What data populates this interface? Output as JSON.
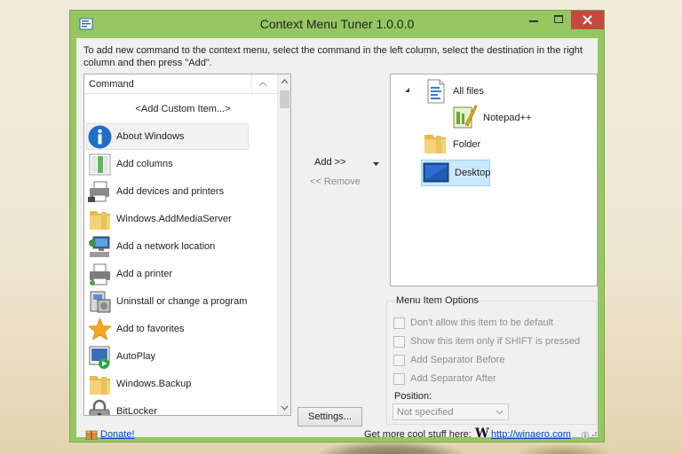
{
  "window": {
    "title": "Context Menu Tuner 1.0.0.0"
  },
  "instructions": "To add new command to the context menu, select the command in the left column, select the destination in the right column and then press \"Add\".",
  "command_list": {
    "header": "Command",
    "items": [
      {
        "label": "<Add Custom Item...>",
        "icon": "none"
      },
      {
        "label": "About Windows",
        "icon": "info-icon"
      },
      {
        "label": "Add columns",
        "icon": "columns-icon"
      },
      {
        "label": "Add devices and printers",
        "icon": "devices-printers-icon"
      },
      {
        "label": "Windows.AddMediaServer",
        "icon": "folder-icon"
      },
      {
        "label": "Add a network location",
        "icon": "network-location-icon"
      },
      {
        "label": "Add a printer",
        "icon": "printer-icon"
      },
      {
        "label": "Uninstall or change a program",
        "icon": "uninstall-program-icon"
      },
      {
        "label": "Add to favorites",
        "icon": "star-icon"
      },
      {
        "label": "AutoPlay",
        "icon": "autoplay-icon"
      },
      {
        "label": "Windows.Backup",
        "icon": "folder-icon"
      },
      {
        "label": "BitLocker",
        "icon": "bitlocker-icon"
      }
    ],
    "selected_index": 1
  },
  "actions": {
    "add_label": "Add >>",
    "remove_label": "<< Remove",
    "settings_label": "Settings..."
  },
  "tree": {
    "items": [
      {
        "label": "All files",
        "icon": "all-files-icon",
        "level": 0,
        "expanded": true
      },
      {
        "label": "Notepad++",
        "icon": "notepad-plus-plus-icon",
        "level": 1
      },
      {
        "label": "Folder",
        "icon": "folder-icon",
        "level": 0
      },
      {
        "label": "Desktop",
        "icon": "desktop-icon",
        "level": 0,
        "selected": true
      }
    ]
  },
  "options": {
    "legend": "Menu Item Options",
    "checkboxes": [
      {
        "label": "Don't allow this item to be default",
        "checked": false,
        "enabled": false
      },
      {
        "label": "Show this item only if SHIFT is pressed",
        "checked": false,
        "enabled": false
      },
      {
        "label": "Add Separator Before",
        "checked": false,
        "enabled": false
      },
      {
        "label": "Add Separator After",
        "checked": false,
        "enabled": false
      }
    ],
    "position_label": "Position:",
    "position_value": "Not specified"
  },
  "status": {
    "donate_label": "Donate!",
    "cool_stuff_text": "Get more cool stuff here:",
    "logo_letter": "W",
    "site_link": "http://winaero.com"
  },
  "colors": {
    "window_frame": "#96c661",
    "close_button": "#c7483f",
    "selection": "#cce8ff",
    "link": "#0044cc"
  }
}
